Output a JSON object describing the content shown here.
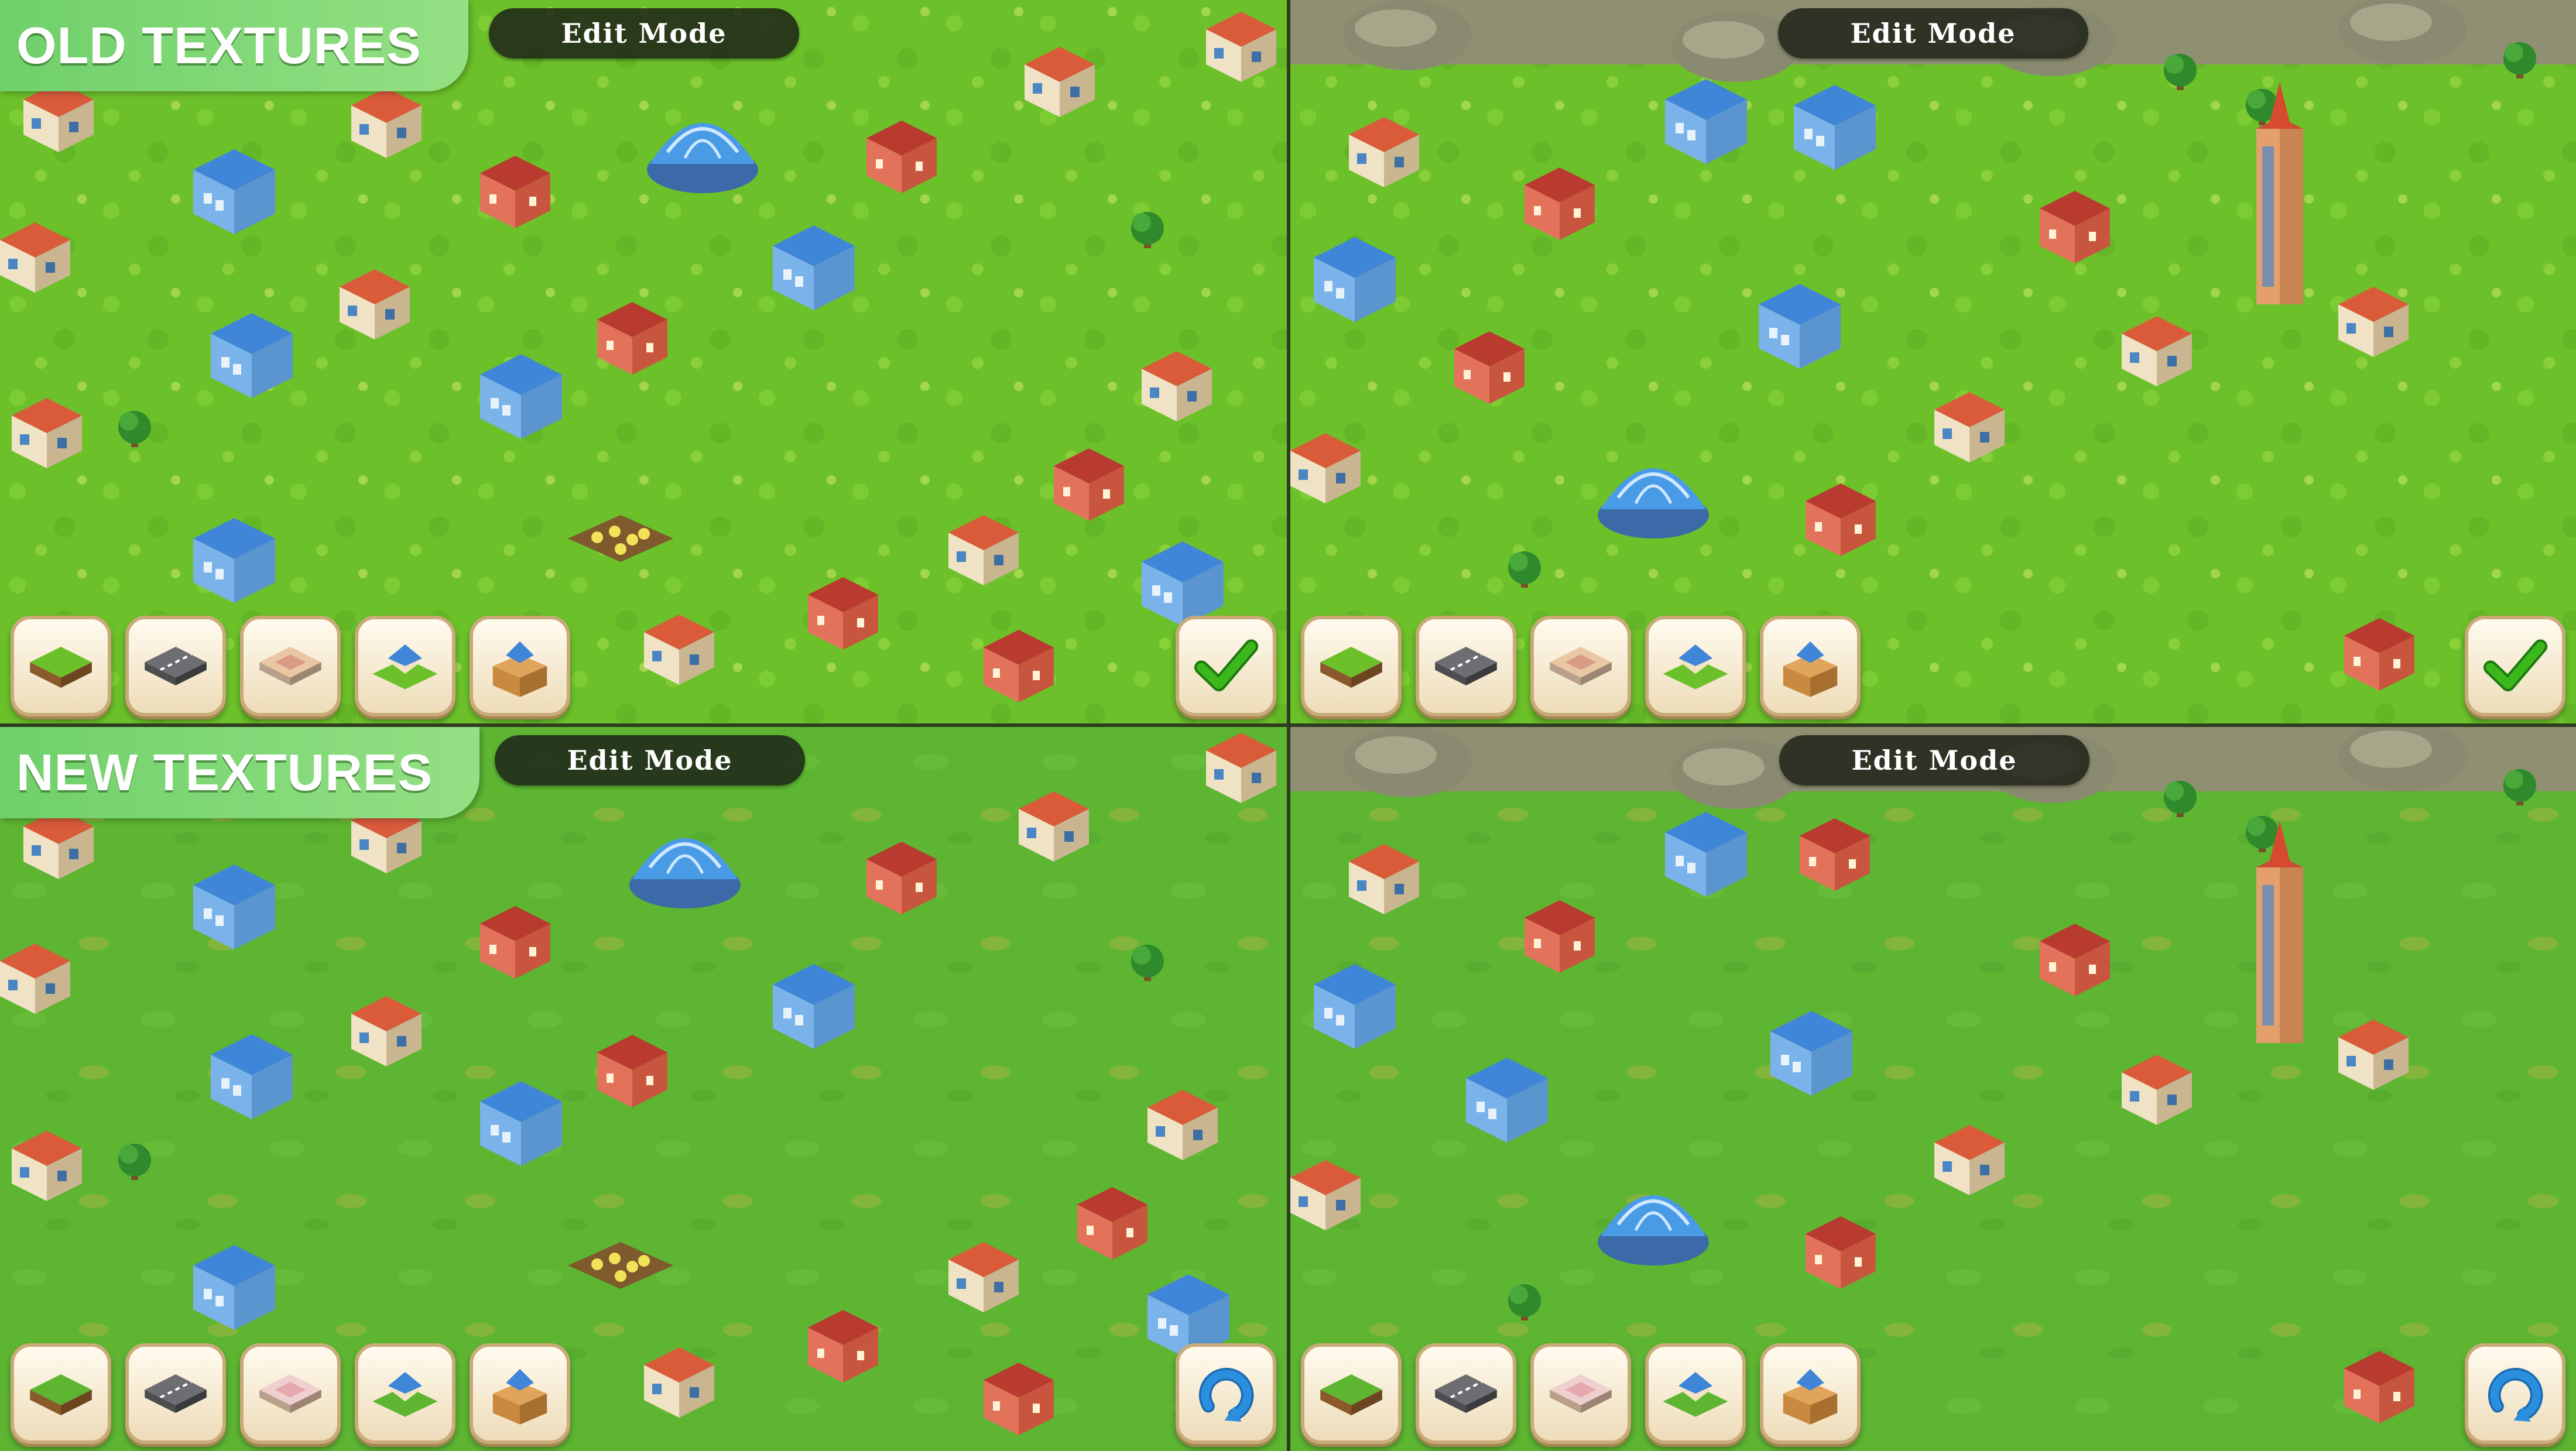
{
  "labels": {
    "old": "OLD TEXTURES",
    "new": "NEW TEXTURES"
  },
  "edit_mode": "Edit Mode",
  "toolbar": {
    "items": [
      {
        "icon": "grass-tile-icon"
      },
      {
        "icon": "road-tile-icon"
      },
      {
        "icon": "pavement-tile-icon"
      },
      {
        "icon": "building-plot-icon"
      },
      {
        "icon": "storage-box-icon"
      }
    ]
  },
  "actions": {
    "old": {
      "icon": "checkmark-icon"
    },
    "new": {
      "icon": "rotate-icon"
    }
  },
  "colors": {
    "grass_old": "#6cc12a",
    "grass_new": "#5db532",
    "label_green": "#7ad774",
    "edit_mode_bg": "#1e2418",
    "button_bg": "#f6ead0",
    "checkmark": "#3cb81c",
    "rotate": "#2b8fe0"
  }
}
